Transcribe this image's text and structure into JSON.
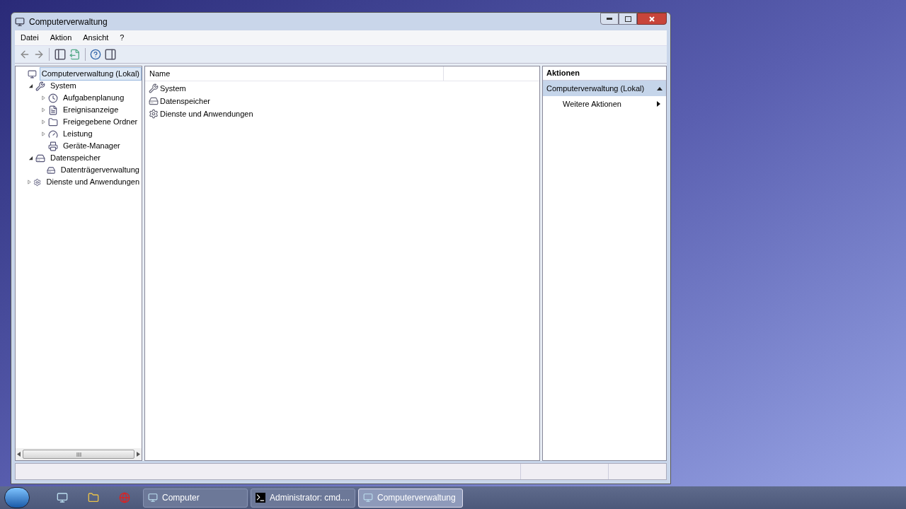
{
  "window": {
    "title": "Computerverwaltung"
  },
  "menu": [
    "Datei",
    "Aktion",
    "Ansicht",
    "?"
  ],
  "tree": [
    {
      "label": "Computerverwaltung (Lokal)",
      "selected": true,
      "children": [
        {
          "label": "System",
          "kind": "node",
          "expanded": true,
          "selected": false,
          "children": [
            {
              "label": "Aufgabenplanung",
              "kind": "node",
              "expanded": false,
              "selected": false
            },
            {
              "label": "Ereignisanzeige",
              "kind": "node",
              "expanded": false,
              "selected": false
            },
            {
              "label": "Freigegebene Ordner",
              "kind": "node",
              "expanded": false,
              "selected": false
            },
            {
              "label": "Leistung",
              "kind": "node",
              "expanded": false,
              "selected": false
            },
            {
              "label": "Geräte-Manager",
              "kind": "leaf",
              "selected": false
            }
          ]
        },
        {
          "label": "Datenspeicher",
          "kind": "node",
          "expanded": true,
          "selected": false,
          "children": [
            {
              "label": "Datenträgerverwaltung",
              "kind": "leaf",
              "selected": false
            }
          ]
        },
        {
          "label": "Dienste und Anwendungen",
          "kind": "node",
          "expanded": false,
          "selected": false
        }
      ]
    }
  ],
  "list": {
    "columns": [
      "Name"
    ],
    "rows": [
      "System",
      "Datenspeicher",
      "Dienste und Anwendungen"
    ]
  },
  "actions": {
    "title": "Aktionen",
    "section": "Computerverwaltung (Lokal)",
    "items": [
      "Weitere Aktionen"
    ]
  },
  "taskbar": {
    "tasks": [
      {
        "label": "Computer",
        "selected": false
      },
      {
        "label": "Administrator: cmd....",
        "selected": false
      },
      {
        "label": "Computerverwaltung",
        "selected": true
      }
    ]
  }
}
